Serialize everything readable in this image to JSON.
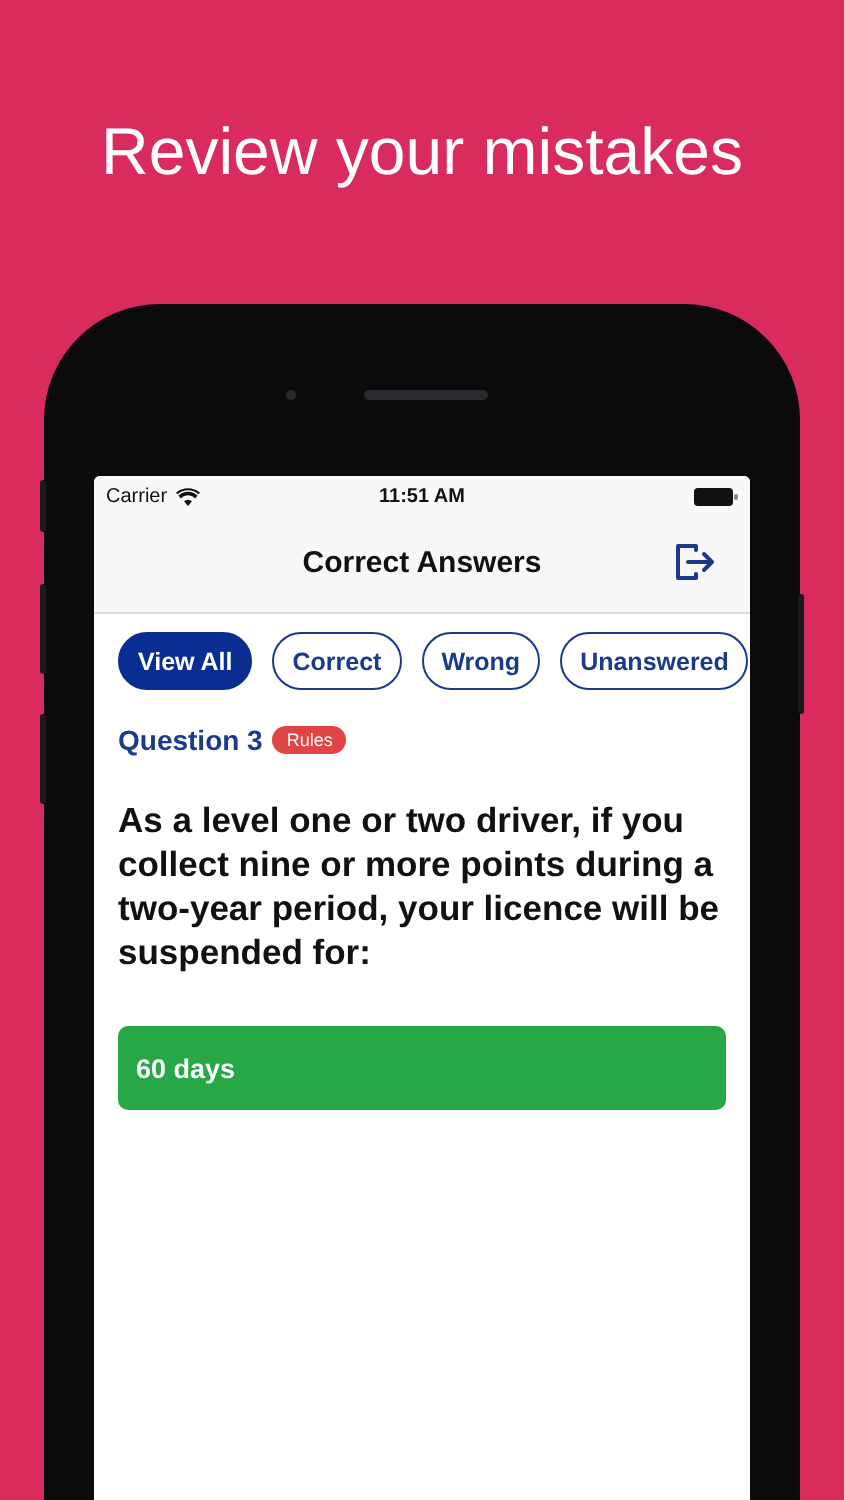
{
  "headline": "Review your mistakes",
  "status_bar": {
    "carrier": "Carrier",
    "time": "11:51 AM"
  },
  "nav": {
    "title": "Correct Answers"
  },
  "filters": [
    {
      "label": "View All",
      "selected": true
    },
    {
      "label": "Correct",
      "selected": false
    },
    {
      "label": "Wrong",
      "selected": false
    },
    {
      "label": "Unanswered",
      "selected": false
    }
  ],
  "question": {
    "number": "Question 3",
    "tag": "Rules",
    "text": "As a level one or two driver, if you collect nine or more points during a two-year period, your licence will be suspended for:"
  },
  "answers": [
    {
      "text": "60 days",
      "kind": "correct"
    }
  ]
}
